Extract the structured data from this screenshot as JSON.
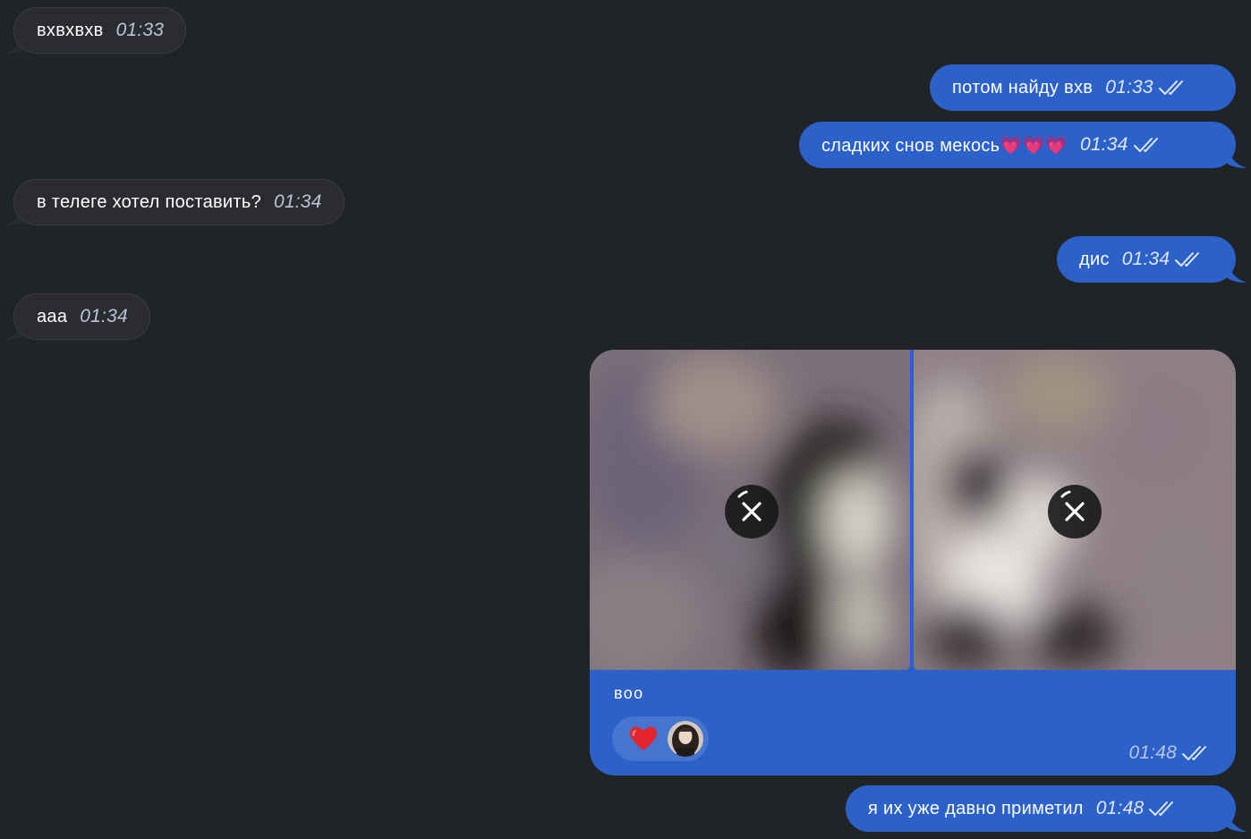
{
  "messages": [
    {
      "direction": "incoming",
      "text": "вхвхвхв",
      "time": "01:33"
    },
    {
      "direction": "outgoing",
      "text": "потом найду вхв",
      "time": "01:33",
      "status": "read"
    },
    {
      "direction": "outgoing",
      "text": "сладких снов мекось💗💗💗",
      "time": "01:34",
      "status": "read"
    },
    {
      "direction": "incoming",
      "text": "в телеге хотел поставить?",
      "time": "01:34"
    },
    {
      "direction": "outgoing",
      "text": "дис",
      "time": "01:34",
      "status": "read"
    },
    {
      "direction": "incoming",
      "text": "ааа",
      "time": "01:34"
    },
    {
      "direction": "outgoing",
      "type": "media",
      "photos": 2,
      "photo_state": "blurred, loading",
      "caption": "воо",
      "reaction": "heart-emoji",
      "time": "01:48",
      "status": "read"
    },
    {
      "direction": "outgoing",
      "text": "я их уже давно приметил",
      "time": "01:48",
      "status": "read"
    }
  ],
  "colors": {
    "background": "#212427",
    "incoming_bubble": "#2a2c30",
    "outgoing_bubble": "#2b61c9",
    "time_incoming": "#bac6d8",
    "time_outgoing": "#dfe7f8"
  }
}
